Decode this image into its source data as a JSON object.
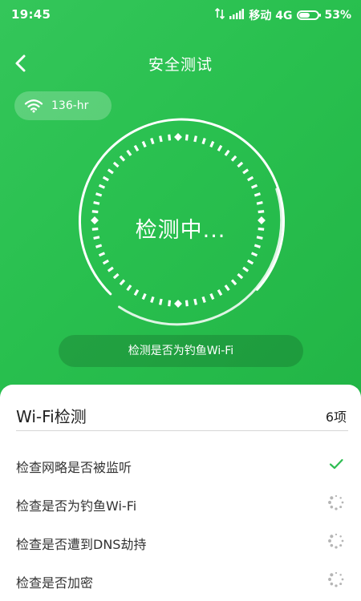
{
  "status_bar": {
    "time": "19:45",
    "carrier": "移动 4G",
    "battery": "53%"
  },
  "header": {
    "title": "安全测试",
    "back_icon": "chevron-left-icon"
  },
  "wifi": {
    "ssid": "136-hr",
    "icon": "wifi-icon"
  },
  "scan": {
    "status_text": "检测中...",
    "current_task": "检测是否为钓鱼Wi-Fi"
  },
  "sheet": {
    "title": "Wi-Fi检测",
    "count": "6项",
    "items": [
      {
        "label": "检查网略是否被监听",
        "status": "done",
        "status_icon": "checkmark-icon"
      },
      {
        "label": "检查是否为钓鱼Wi-Fi",
        "status": "pending",
        "status_icon": "loading-spinner-icon"
      },
      {
        "label": "检查是否遭到DNS劫持",
        "status": "pending",
        "status_icon": "loading-spinner-icon"
      },
      {
        "label": "检查是否加密",
        "status": "pending",
        "status_icon": "loading-spinner-icon"
      }
    ]
  },
  "colors": {
    "primary_green": "#29c04f",
    "check_green": "#2ebd52",
    "spinner_gray": "#b5b5b5"
  }
}
